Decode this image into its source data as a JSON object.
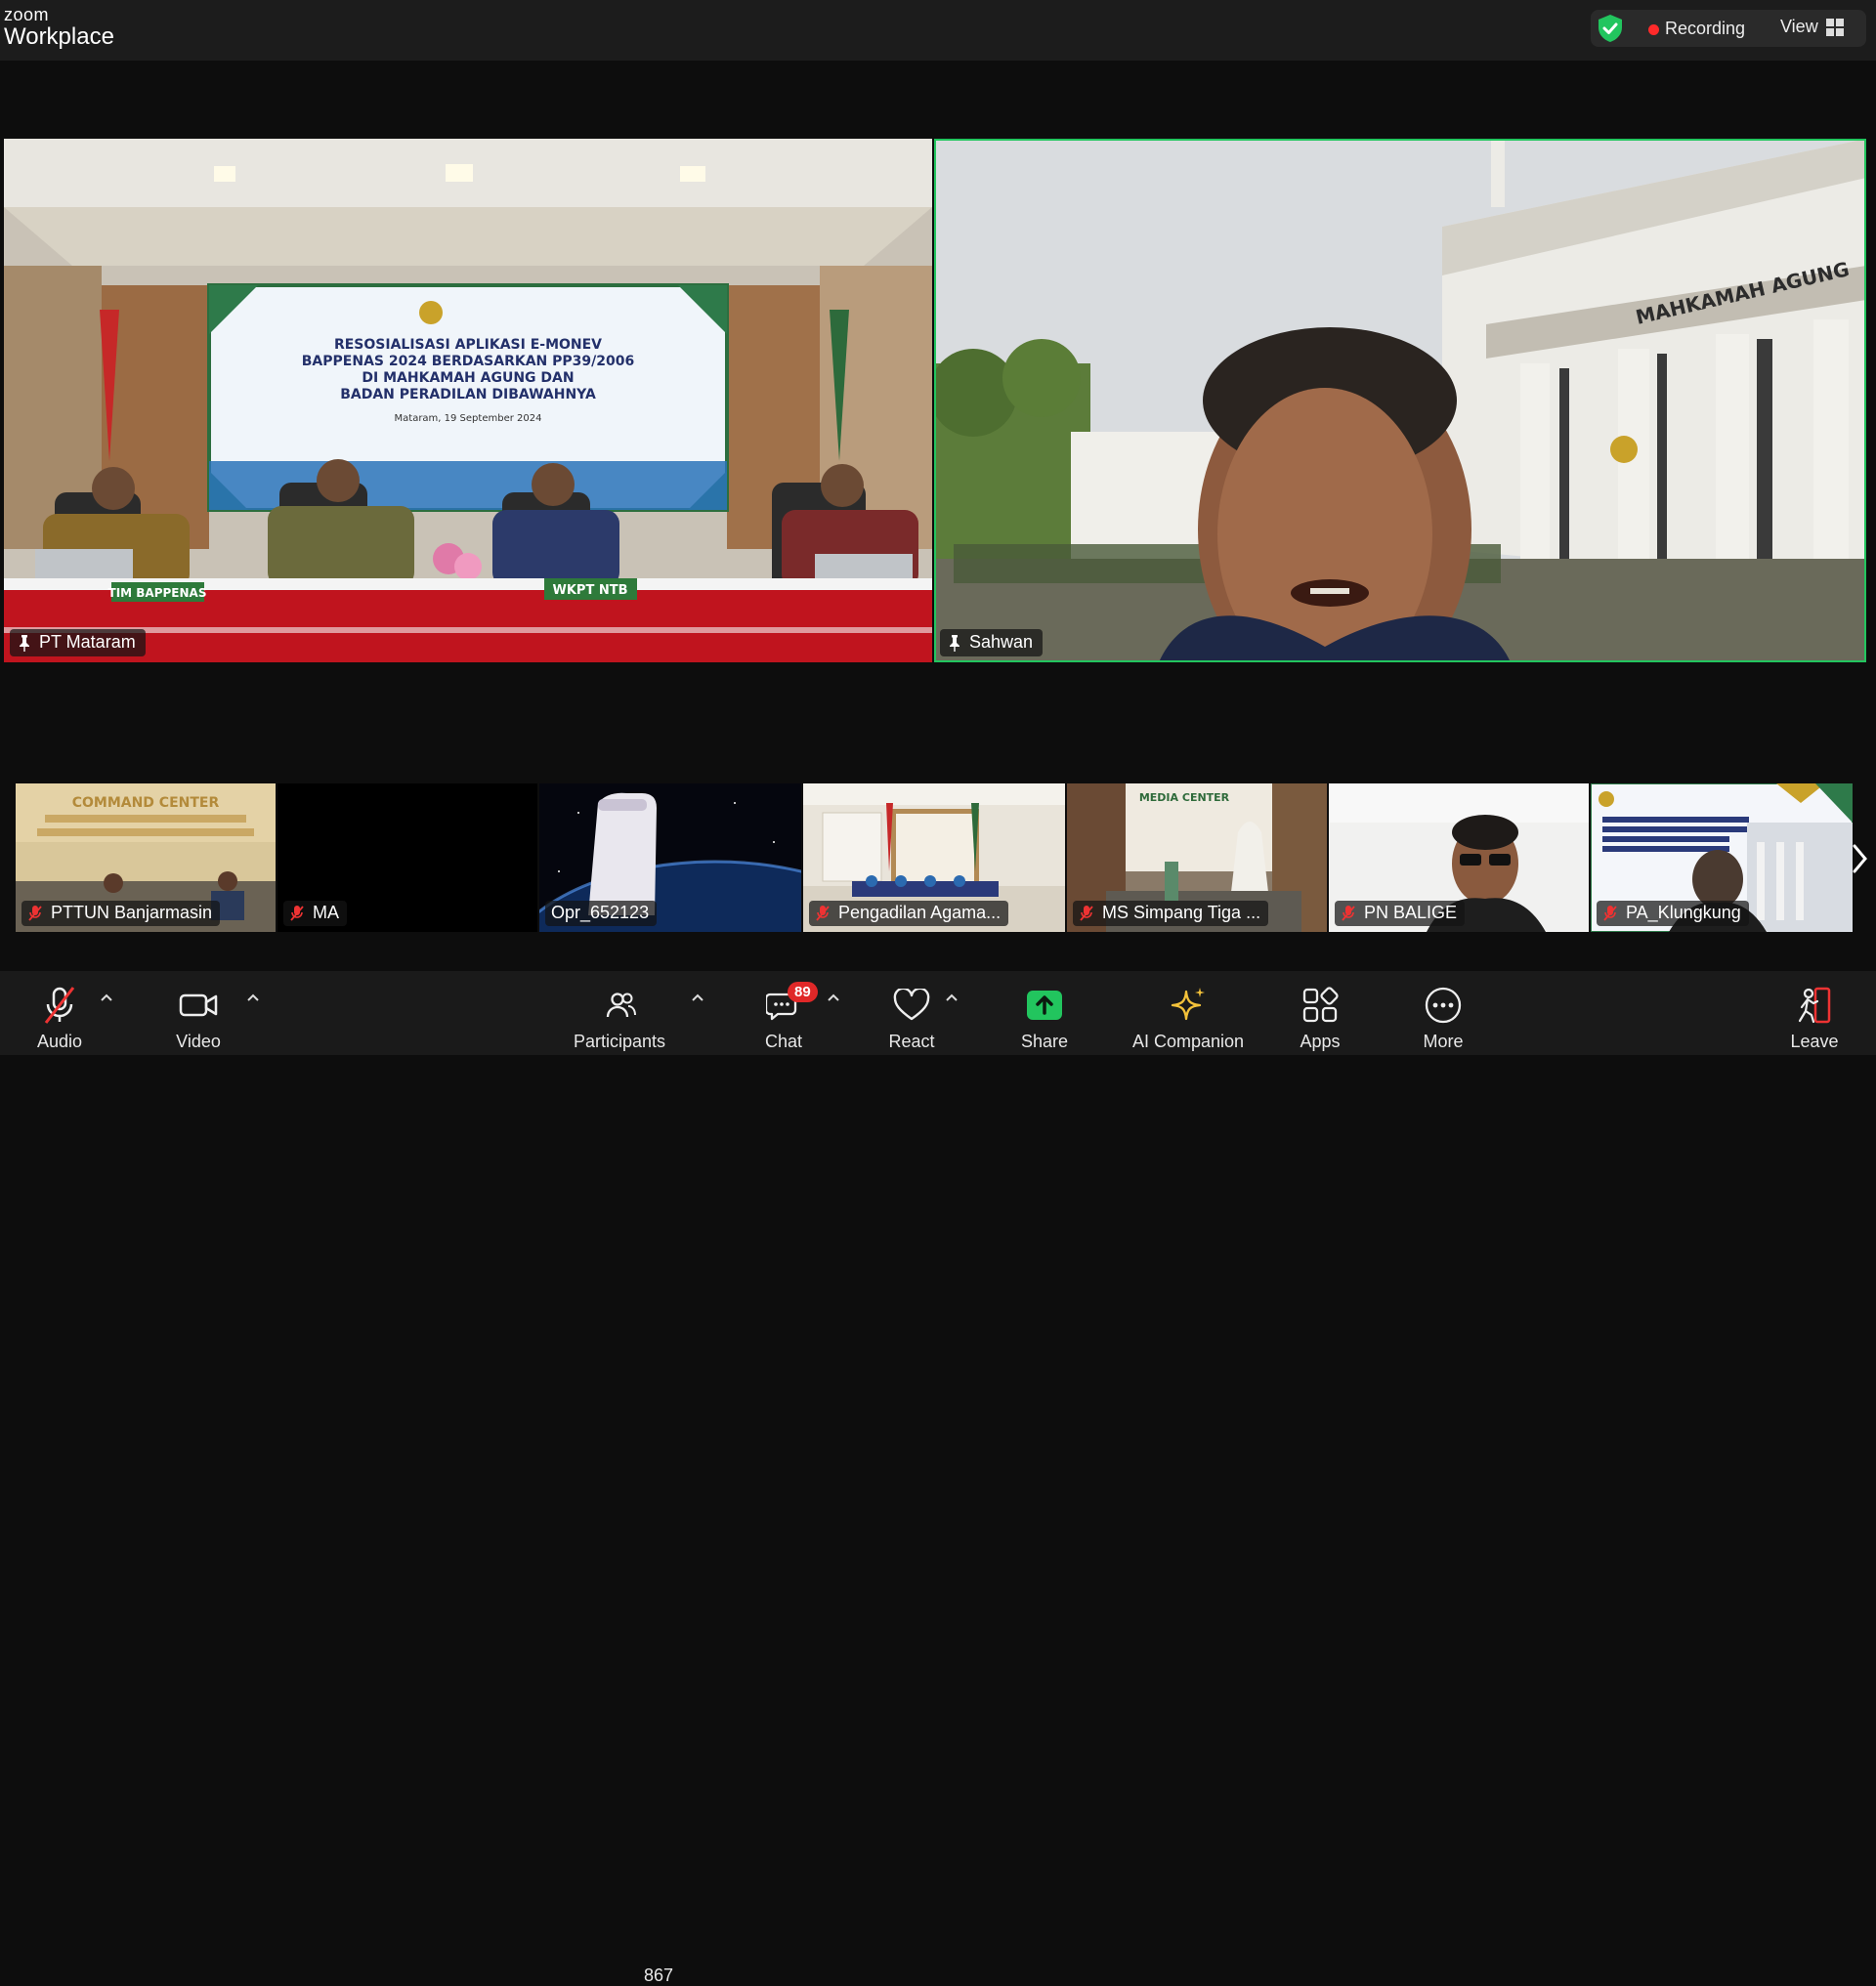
{
  "app": {
    "logo_top": "zoom",
    "logo_bottom": "Workplace"
  },
  "status": {
    "recording_label": "Recording",
    "view_label": "View",
    "accent": "#22c55e",
    "recording_color": "#ff2a2a"
  },
  "main_tiles": [
    {
      "name": "PT Mataram",
      "pinned": true,
      "active_speaker": false
    },
    {
      "name": "Sahwan",
      "pinned": true,
      "active_speaker": true
    }
  ],
  "banner": {
    "line1": "RESOSIALISASI APLIKASI E-MONEV",
    "line2": "BAPPENAS 2024 BERDASARKAN PP39/2006",
    "line3": "DI MAHKAMAH AGUNG DAN",
    "line4": "BADAN PERADILAN DIBAWAHNYA",
    "date": "Mataram, 19 September 2024"
  },
  "nameplates": [
    "TIM BAPPENAS",
    "WKPT NTB"
  ],
  "building_sign": "MAHKAMAH AGUNG",
  "thumbnails": [
    {
      "name": "PTTUN Banjarmasin",
      "muted": true,
      "sign": "COMMAND CENTER"
    },
    {
      "name": "MA",
      "muted": true
    },
    {
      "name": "Opr_652123",
      "muted": false
    },
    {
      "name": "Pengadilan Agama...",
      "muted": true
    },
    {
      "name": "MS Simpang Tiga ...",
      "muted": true,
      "sign": "MEDIA CENTER"
    },
    {
      "name": "PN BALIGE",
      "muted": true
    },
    {
      "name": "PA_Klungkung",
      "muted": true
    }
  ],
  "toolbar": {
    "audio": "Audio",
    "video": "Video",
    "participants": "Participants",
    "participants_count": "867",
    "chat": "Chat",
    "chat_badge": "89",
    "react": "React",
    "share": "Share",
    "ai_companion": "AI Companion",
    "apps": "Apps",
    "more": "More",
    "leave": "Leave"
  }
}
